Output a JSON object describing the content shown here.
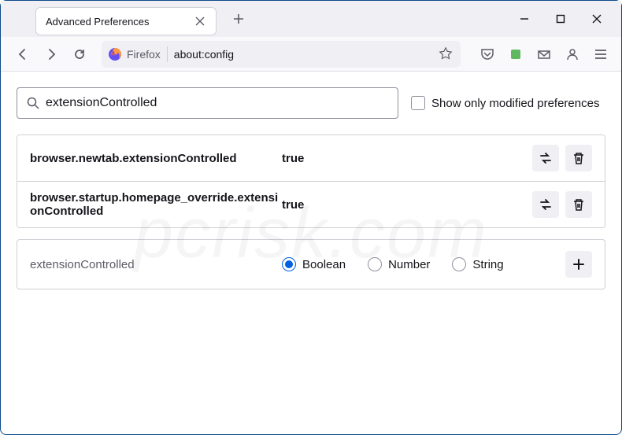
{
  "tab": {
    "title": "Advanced Preferences"
  },
  "url": {
    "prefix": "Firefox",
    "path": "about:config"
  },
  "search": {
    "value": "extensionControlled",
    "checkbox_label": "Show only modified preferences"
  },
  "prefs": [
    {
      "name": "browser.newtab.extensionControlled",
      "value": "true"
    },
    {
      "name": "browser.startup.homepage_override.extensionControlled",
      "value": "true"
    }
  ],
  "new_pref": {
    "name": "extensionControlled",
    "types": [
      "Boolean",
      "Number",
      "String"
    ],
    "selected": "Boolean"
  },
  "watermark": "pcrisk.com"
}
